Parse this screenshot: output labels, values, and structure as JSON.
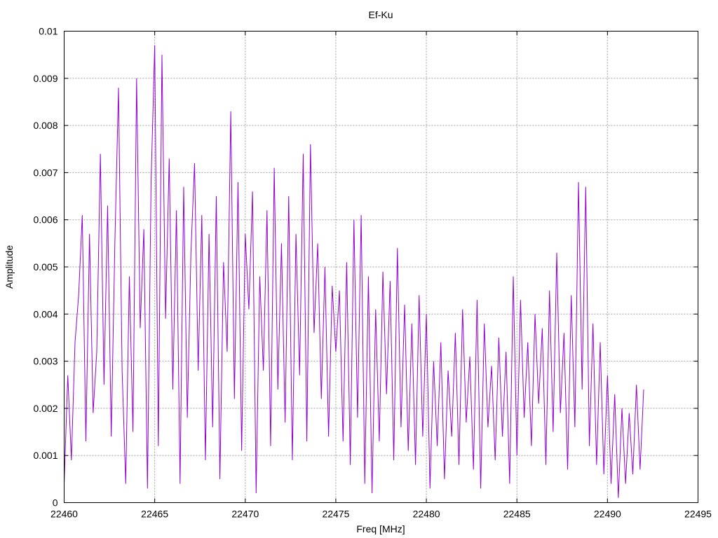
{
  "chart_data": {
    "type": "line",
    "title": "Ef-Ku",
    "xlabel": "Freq [MHz]",
    "ylabel": "Amplitude",
    "xlim": [
      22460,
      22495
    ],
    "ylim": [
      0,
      0.01
    ],
    "xticks": [
      "22460",
      "22465",
      "22470",
      "22475",
      "22480",
      "22485",
      "22490",
      "22495"
    ],
    "yticks": [
      "0",
      "0.001",
      "0.002",
      "0.003",
      "0.004",
      "0.005",
      "0.006",
      "0.007",
      "0.008",
      "0.009",
      "0.01"
    ],
    "grid": true,
    "series": [
      {
        "color": "#9400d3",
        "x": [
          22460.0,
          22460.2,
          22460.4,
          22460.6,
          22460.8,
          22461.0,
          22461.2,
          22461.4,
          22461.6,
          22461.8,
          22462.0,
          22462.2,
          22462.4,
          22462.6,
          22462.8,
          22463.0,
          22463.2,
          22463.4,
          22463.6,
          22463.8,
          22464.0,
          22464.2,
          22464.4,
          22464.6,
          22464.8,
          22465.0,
          22465.2,
          22465.4,
          22465.6,
          22465.8,
          22466.0,
          22466.2,
          22466.4,
          22466.6,
          22466.8,
          22467.0,
          22467.2,
          22467.4,
          22467.6,
          22467.8,
          22468.0,
          22468.2,
          22468.4,
          22468.6,
          22468.8,
          22469.0,
          22469.2,
          22469.4,
          22469.6,
          22469.8,
          22470.0,
          22470.2,
          22470.4,
          22470.6,
          22470.8,
          22471.0,
          22471.2,
          22471.4,
          22471.6,
          22471.8,
          22472.0,
          22472.2,
          22472.4,
          22472.6,
          22472.8,
          22473.0,
          22473.2,
          22473.4,
          22473.6,
          22473.8,
          22474.0,
          22474.2,
          22474.4,
          22474.6,
          22474.8,
          22475.0,
          22475.2,
          22475.4,
          22475.6,
          22475.8,
          22476.0,
          22476.2,
          22476.4,
          22476.6,
          22476.8,
          22477.0,
          22477.2,
          22477.4,
          22477.6,
          22477.8,
          22478.0,
          22478.2,
          22478.4,
          22478.6,
          22478.8,
          22479.0,
          22479.2,
          22479.4,
          22479.6,
          22479.8,
          22480.0,
          22480.2,
          22480.4,
          22480.6,
          22480.8,
          22481.0,
          22481.2,
          22481.4,
          22481.6,
          22481.8,
          22482.0,
          22482.2,
          22482.4,
          22482.6,
          22482.8,
          22483.0,
          22483.2,
          22483.4,
          22483.6,
          22483.8,
          22484.0,
          22484.2,
          22484.4,
          22484.6,
          22484.8,
          22485.0,
          22485.2,
          22485.4,
          22485.6,
          22485.8,
          22486.0,
          22486.2,
          22486.4,
          22486.6,
          22486.8,
          22487.0,
          22487.2,
          22487.4,
          22487.6,
          22487.8,
          22488.0,
          22488.2,
          22488.4,
          22488.6,
          22488.8,
          22489.0,
          22489.2,
          22489.4,
          22489.6,
          22489.8,
          22490.0,
          22490.2,
          22490.4,
          22490.6,
          22490.8,
          22491.0,
          22491.2,
          22491.4,
          22491.6,
          22491.8,
          22492.0
        ],
        "y": [
          0.0004,
          0.0027,
          0.0009,
          0.0034,
          0.0044,
          0.0061,
          0.0013,
          0.0057,
          0.0019,
          0.0032,
          0.0074,
          0.0025,
          0.0063,
          0.0014,
          0.0055,
          0.0088,
          0.0028,
          0.0004,
          0.0048,
          0.0015,
          0.009,
          0.0037,
          0.0058,
          0.0003,
          0.0068,
          0.0097,
          0.0012,
          0.0095,
          0.0039,
          0.0073,
          0.0024,
          0.0062,
          0.0004,
          0.0067,
          0.0018,
          0.0053,
          0.0072,
          0.0028,
          0.0061,
          0.0009,
          0.0057,
          0.0016,
          0.0065,
          0.0005,
          0.0051,
          0.0032,
          0.0083,
          0.0022,
          0.0068,
          0.0011,
          0.0057,
          0.0041,
          0.0066,
          0.0002,
          0.0048,
          0.0028,
          0.0062,
          0.0012,
          0.0071,
          0.0024,
          0.0055,
          0.0017,
          0.0065,
          0.0009,
          0.0057,
          0.0027,
          0.0074,
          0.0013,
          0.0076,
          0.0036,
          0.0055,
          0.0022,
          0.005,
          0.0014,
          0.0046,
          0.0032,
          0.0045,
          0.0013,
          0.0051,
          0.0008,
          0.006,
          0.0018,
          0.0061,
          0.0004,
          0.0048,
          0.0002,
          0.0041,
          0.0013,
          0.0049,
          0.0023,
          0.0047,
          0.0009,
          0.0054,
          0.0016,
          0.0042,
          0.0011,
          0.0038,
          0.0008,
          0.0044,
          0.0014,
          0.004,
          0.0003,
          0.003,
          0.0012,
          0.0034,
          0.0005,
          0.0028,
          0.0014,
          0.0036,
          0.0008,
          0.0041,
          0.0017,
          0.0031,
          0.0007,
          0.0043,
          0.0003,
          0.0038,
          0.0016,
          0.0029,
          0.0009,
          0.0035,
          0.0014,
          0.0032,
          0.0004,
          0.0048,
          0.001,
          0.0043,
          0.0018,
          0.0034,
          0.0012,
          0.004,
          0.0021,
          0.0037,
          0.0008,
          0.0045,
          0.0015,
          0.0053,
          0.0019,
          0.0036,
          0.0007,
          0.0044,
          0.0016,
          0.0068,
          0.0024,
          0.0067,
          0.0012,
          0.0038,
          0.0008,
          0.0034,
          0.0006,
          0.0027,
          0.0004,
          0.0023,
          0.0001,
          0.002,
          0.0004,
          0.0019,
          0.0006,
          0.0025,
          0.0007,
          0.0024
        ]
      }
    ]
  }
}
